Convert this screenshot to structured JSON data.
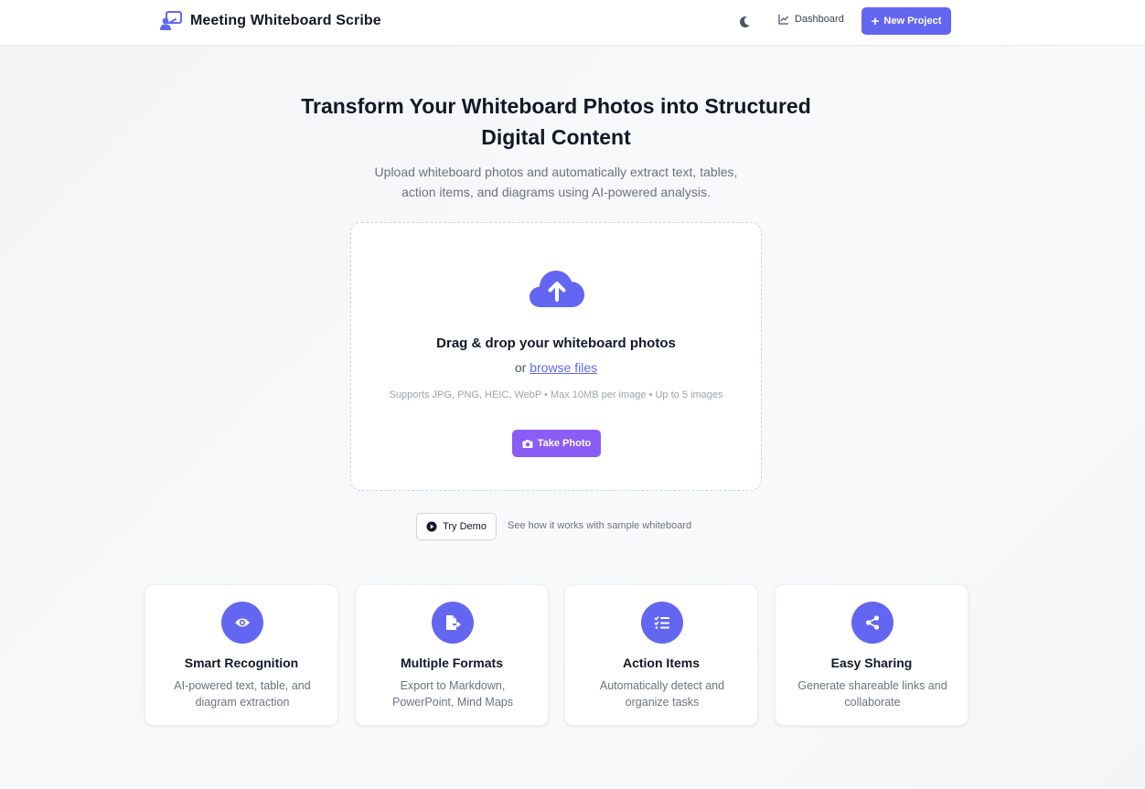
{
  "header": {
    "title": "Meeting Whiteboard Scribe",
    "dashboard_label": "Dashboard",
    "new_project_label": "New Project"
  },
  "hero": {
    "title_line1": "Transform Your Whiteboard Photos into Structured",
    "title_line2": "Digital Content",
    "subtitle_line1": "Upload whiteboard photos and automatically extract text, tables,",
    "subtitle_line2": "action items, and diagrams using AI-powered analysis."
  },
  "upload": {
    "title": "Drag & drop your whiteboard photos",
    "or_text": "or ",
    "browse_label": "browse files",
    "supports": "Supports JPG, PNG, HEIC, WebP • Max 10MB per image • Up to 5 images",
    "take_photo_label": "Take Photo"
  },
  "demo": {
    "button_label": "Try Demo",
    "hint": "See how it works with sample whiteboard"
  },
  "features": [
    {
      "icon": "eye-icon",
      "title": "Smart Recognition",
      "desc_line1": "AI-powered text, table, and",
      "desc_line2": "diagram extraction"
    },
    {
      "icon": "file-export-icon",
      "title": "Multiple Formats",
      "desc_line1": "Export to Markdown,",
      "desc_line2": "PowerPoint, Mind Maps"
    },
    {
      "icon": "task-list-icon",
      "title": "Action Items",
      "desc_line1": "Automatically detect and",
      "desc_line2": "organize tasks"
    },
    {
      "icon": "share-icon",
      "title": "Easy Sharing",
      "desc_line1": "Generate shareable links and",
      "desc_line2": "collaborate"
    }
  ],
  "colors": {
    "accent": "#6366f1",
    "photo_button": "#8b5cf6",
    "text_primary": "#111827",
    "text_muted": "#6b7280"
  }
}
